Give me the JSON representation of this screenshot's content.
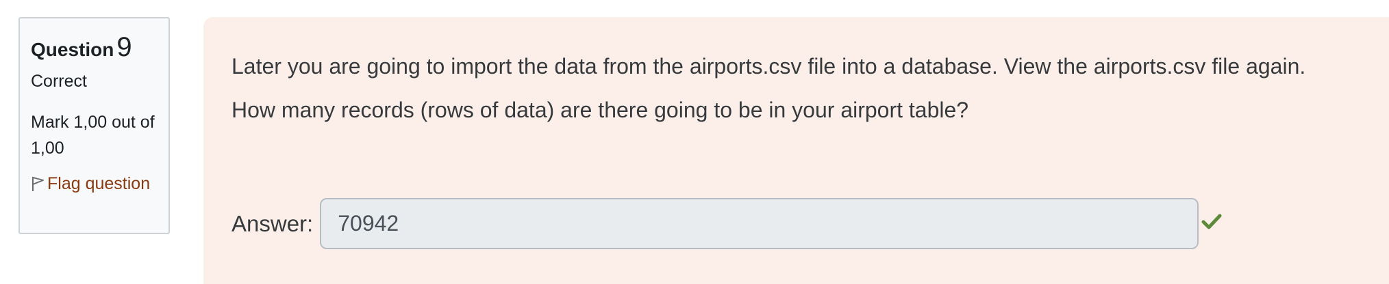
{
  "question": {
    "label": "Question",
    "number": "9",
    "state": "Correct",
    "grade": "Mark 1,00 out of 1,00",
    "flag_label": "Flag question"
  },
  "content": {
    "line1": "Later you are going to import the data from the airports.csv file into a database. View the airports.csv file again.",
    "line2": "How many records (rows of data) are there going to be in your airport table?"
  },
  "answer": {
    "label": "Answer:",
    "value": "70942",
    "status_icon": "check-icon"
  },
  "colors": {
    "content_bg": "#fcefea",
    "flag_link": "#8a3a10",
    "correct": "#5b8a3a"
  }
}
